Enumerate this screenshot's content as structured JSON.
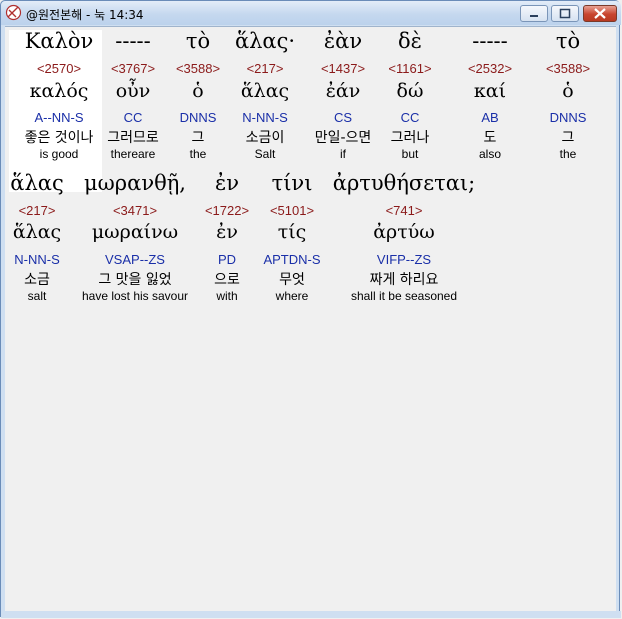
{
  "window": {
    "title": "@원전본해 - 눅 14:34"
  },
  "lines": [
    {
      "tokens": [
        {
          "word": "Καλὸν",
          "strong": "<2570>",
          "lemma": "καλός",
          "parse": "A--NN-S",
          "korean": "좋은 것이나",
          "english": "is good"
        },
        {
          "word": "-----",
          "strong": "<3767>",
          "lemma": "οὖν",
          "parse": "CC",
          "korean": "그러므로",
          "english": "thereare"
        },
        {
          "word": "τὸ",
          "strong": "<3588>",
          "lemma": "ὁ",
          "parse": "DNNS",
          "korean": "그",
          "english": "the"
        },
        {
          "word": "ἅλας·",
          "strong": "<217>",
          "lemma": "ἅλας",
          "parse": "N-NN-S",
          "korean": "소금이",
          "english": "Salt"
        },
        {
          "word": "ἐὰν",
          "strong": "<1437>",
          "lemma": "ἐάν",
          "parse": "CS",
          "korean": "만일-으면",
          "english": "if"
        },
        {
          "word": "δὲ",
          "strong": "<1161>",
          "lemma": "δώ",
          "parse": "CC",
          "korean": "그러나",
          "english": "but"
        },
        {
          "word": "-----",
          "strong": "<2532>",
          "lemma": "καί",
          "parse": "AB",
          "korean": "도",
          "english": "also"
        },
        {
          "word": "τὸ",
          "strong": "<3588>",
          "lemma": "ὁ",
          "parse": "DNNS",
          "korean": "그",
          "english": "the"
        }
      ]
    },
    {
      "tokens": [
        {
          "word": "ἅλας",
          "strong": "<217>",
          "lemma": "ἅλας",
          "parse": "N-NN-S",
          "korean": "소금",
          "english": "salt"
        },
        {
          "word": "μωρανθῇ,",
          "strong": "<3471>",
          "lemma": "μωραίνω",
          "parse": "VSAP--ZS",
          "korean": "그 맛을 잃었",
          "english": "have lost his savour"
        },
        {
          "word": "ἐν",
          "strong": "<1722>",
          "lemma": "ἐν",
          "parse": "PD",
          "korean": "으로",
          "english": "with"
        },
        {
          "word": "τίνι",
          "strong": "<5101>",
          "lemma": "τίς",
          "parse": "APTDN-S",
          "korean": "무엇",
          "english": "where"
        },
        {
          "word": "ἀρτυθήσεται;",
          "strong": "<741>",
          "lemma": "ἀρτύω",
          "parse": "VIFP--ZS",
          "korean": "짜게 하리요",
          "english": "shall it be seasoned"
        }
      ]
    }
  ],
  "colors": {
    "strong": "#8b1a1a",
    "parse": "#1a2fa8",
    "highlight": "#ffffff"
  }
}
